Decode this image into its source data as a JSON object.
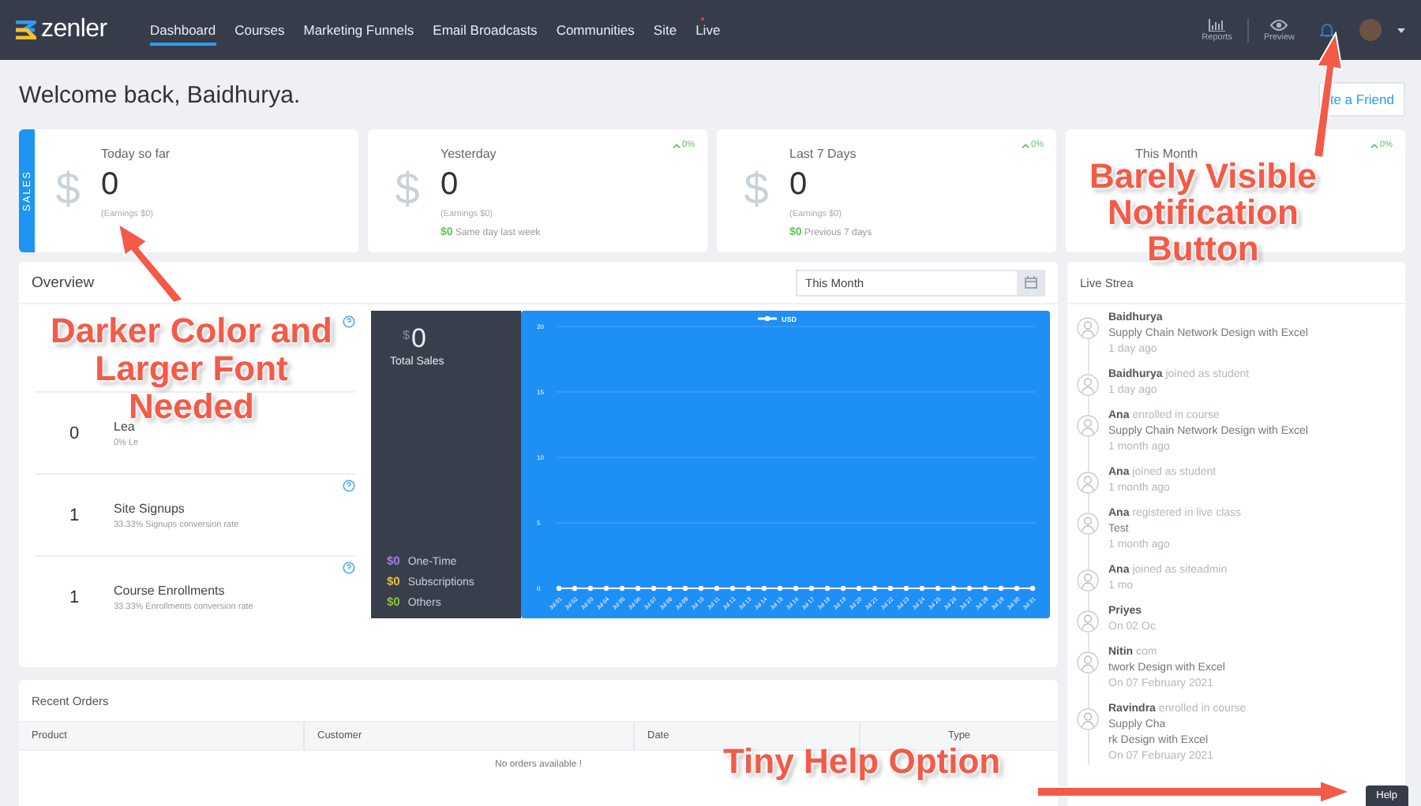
{
  "topbar": {
    "logo": "zenler",
    "nav": [
      {
        "label": "Dashboard",
        "selected": true,
        "dot": false
      },
      {
        "label": "Courses",
        "selected": false,
        "dot": false
      },
      {
        "label": "Marketing Funnels",
        "selected": false,
        "dot": false
      },
      {
        "label": "Email Broadcasts",
        "selected": false,
        "dot": false
      },
      {
        "label": "Communities",
        "selected": false,
        "dot": false
      },
      {
        "label": "Site",
        "selected": false,
        "dot": false
      },
      {
        "label": "Live",
        "selected": false,
        "dot": true
      }
    ],
    "tools": [
      {
        "label": "Reports",
        "kind": "chart"
      },
      {
        "label": "Preview",
        "kind": "eye"
      }
    ]
  },
  "welcome": "Welcome back, Baidhurya.",
  "invite_button": "te a Friend",
  "stats": [
    {
      "tag": "SALES",
      "icon": "$",
      "title": "Today so far",
      "value": "0",
      "earnings": "(Earnings $0)"
    },
    {
      "icon": "$",
      "title": "Yesterday",
      "value": "0",
      "earnings": "(Earnings $0)",
      "change": "0%",
      "compare_value": "$0",
      "compare_label": "Same day last week"
    },
    {
      "icon": "$",
      "title": "Last 7 Days",
      "value": "0",
      "earnings": "(Earnings $0)",
      "change": "0%",
      "compare_value": "$0",
      "compare_label": "Previous 7 days"
    },
    {
      "title": "This Month",
      "change": "0%"
    }
  ],
  "overview": {
    "title": "Overview",
    "date_range": "This Month",
    "metrics": [
      {
        "value": "0",
        "label": "Lea",
        "sub": "0% Le"
      },
      {
        "value": "1",
        "label": "Site Signups",
        "sub": "33.33% Signups conversion rate"
      },
      {
        "value": "1",
        "label": "Course Enrollments",
        "sub": "33.33% Enrollments conversion rate"
      }
    ],
    "total": {
      "currency": "$",
      "value": "0",
      "label": "Total Sales"
    },
    "breakdown": [
      {
        "amount": "$0",
        "label": "One-Time",
        "color": "#a77de0"
      },
      {
        "amount": "$0",
        "label": "Subscriptions",
        "color": "#e3c33b"
      },
      {
        "amount": "$0",
        "label": "Others",
        "color": "#8cc63f"
      }
    ],
    "chart_data": {
      "type": "line",
      "categories": [
        "Jul 01",
        "Jul 02",
        "Jul 03",
        "Jul 04",
        "Jul 05",
        "Jul 06",
        "Jul 07",
        "Jul 08",
        "Jul 09",
        "Jul 10",
        "Jul 11",
        "Jul 12",
        "Jul 13",
        "Jul 14",
        "Jul 15",
        "Jul 16",
        "Jul 17",
        "Jul 18",
        "Jul 19",
        "Jul 20",
        "Jul 21",
        "Jul 22",
        "Jul 23",
        "Jul 24",
        "Jul 25",
        "Jul 26",
        "Jul 27",
        "Jul 28",
        "Jul 29",
        "Jul 30",
        "Jul 31"
      ],
      "series": [
        {
          "name": "USD",
          "color": "#ffffff",
          "marker": "circle",
          "values": [
            0,
            0,
            0,
            0,
            0,
            0,
            0,
            0,
            0,
            0,
            0,
            0,
            0,
            0,
            0,
            0,
            0,
            0,
            0,
            0,
            0,
            0,
            0,
            0,
            0,
            0,
            0,
            0,
            0,
            0,
            0
          ]
        }
      ],
      "ylim": [
        0,
        20
      ],
      "yticks": [
        0,
        5,
        10,
        15,
        20
      ],
      "grid": true
    }
  },
  "recent_orders": {
    "title": "Recent Orders",
    "columns": [
      "Product",
      "Customer",
      "Date",
      "Type"
    ],
    "empty": "No orders available !"
  },
  "live_stream": {
    "title": "Live Strea",
    "items": [
      {
        "actor": "Baidhurya",
        "target": [
          "Supply Chain Network Design with Excel"
        ],
        "time": "1 day ago"
      },
      {
        "actor": "Baidhurya",
        "action": "joined as student",
        "time": "1 day ago"
      },
      {
        "actor": "Ana",
        "action": "enrolled in course",
        "target": [
          "Supply Chain Network Design with Excel"
        ],
        "time": "1 month ago"
      },
      {
        "actor": "Ana",
        "action": "joined as student",
        "time": "1 month ago"
      },
      {
        "actor": "Ana",
        "action": "registered in live class",
        "target": [
          "Test"
        ],
        "time": "1 month ago"
      },
      {
        "actor": "Ana",
        "action": "joined as siteadmin",
        "time": "1 mo"
      },
      {
        "actor": "Priyes",
        "time": "On 02 Oc"
      },
      {
        "actor": "Nitin",
        "action": "com",
        "target": [
          "twork Design with Excel"
        ],
        "time": "On 07 February 2021"
      },
      {
        "actor": "Ravindra",
        "action": "enrolled in course",
        "target": [
          "Supply Cha",
          "rk Design with Excel"
        ],
        "time": "On 07 February 2021"
      }
    ]
  },
  "help_button": "Help",
  "callouts": [
    {
      "lines": [
        "Darker Color and",
        "Larger Font",
        "Needed"
      ]
    },
    {
      "lines": [
        "Barely Visible",
        "Notification",
        "Button"
      ]
    },
    {
      "lines": [
        "Tiny Help Option"
      ]
    }
  ]
}
